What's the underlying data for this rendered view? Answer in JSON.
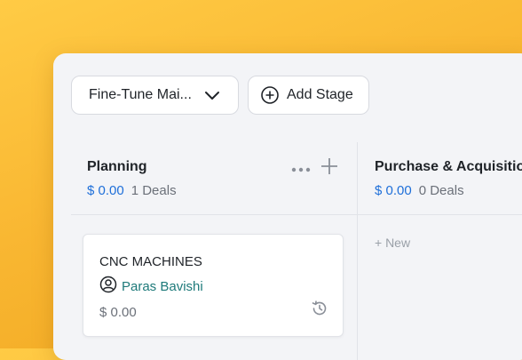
{
  "toolbar": {
    "pipeline_select": {
      "value": "Fine-Tune Mai...",
      "icon": "chevron-down-icon"
    },
    "add_stage": {
      "label": "Add Stage",
      "icon": "plus-circle-icon"
    }
  },
  "stages": [
    {
      "title": "Planning",
      "amount": "$ 0.00",
      "count": "1 Deals"
    },
    {
      "title": "Purchase & Acquisition",
      "amount": "$ 0.00",
      "count": "0 Deals",
      "new_label": "+ New"
    }
  ],
  "card": {
    "title": "CNC MACHINES",
    "owner": "Paras Bavishi",
    "amount": "$ 0.00"
  },
  "colors": {
    "accent": "#1E6FD9",
    "owner": "#1E7A7A",
    "background": "#F9B732"
  }
}
